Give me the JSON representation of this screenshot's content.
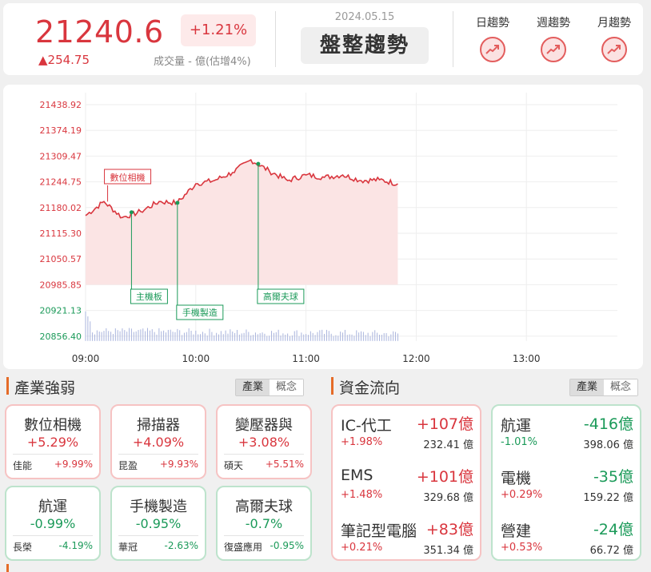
{
  "quote": {
    "price": "21240.6",
    "change": "▲254.75",
    "percent": "+1.21%",
    "volume": "成交量 - 億(估增4%)",
    "date": "2024.05.15",
    "trend": "盤整趨勢"
  },
  "trends": [
    {
      "label": "日趨勢",
      "icon": "trend-up-icon"
    },
    {
      "label": "週趨勢",
      "icon": "trend-up-icon"
    },
    {
      "label": "月趨勢",
      "icon": "trend-up-icon"
    }
  ],
  "colors": {
    "up": "#d9363e",
    "down": "#1b9a59",
    "accent": "#e56b28"
  },
  "chart_data": {
    "type": "line",
    "ylabels": [
      "21438.92",
      "21374.19",
      "21309.47",
      "21244.75",
      "21180.02",
      "21115.30",
      "21050.57",
      "20985.85",
      "20921.13",
      "20856.40"
    ],
    "ylim": [
      20856.4,
      21438.92
    ],
    "xlabels": [
      "09:00",
      "10:00",
      "11:00",
      "12:00",
      "13:00"
    ],
    "x_minutes": [
      0,
      10,
      20,
      30,
      40,
      50,
      60,
      70,
      80,
      90,
      100,
      110,
      120,
      130,
      140,
      150,
      160,
      170
    ],
    "values": [
      21160,
      21195,
      21155,
      21170,
      21195,
      21192,
      21240,
      21248,
      21268,
      21300,
      21272,
      21248,
      21262,
      21256,
      21262,
      21248,
      21250,
      21240
    ],
    "annotations": [
      {
        "label": "數位相機",
        "minute": 12,
        "value": 21195,
        "side": "up"
      },
      {
        "label": "主機板",
        "minute": 25,
        "value": 21168,
        "side": "down"
      },
      {
        "label": "手機製造",
        "minute": 50,
        "value": 21192,
        "side": "down"
      },
      {
        "label": "高爾夫球",
        "minute": 94,
        "value": 21290,
        "side": "down"
      }
    ]
  },
  "industry": {
    "title": "產業強弱",
    "tabs": [
      "產業",
      "概念"
    ],
    "cards": [
      {
        "name": "數位相機",
        "pct": "+5.29%",
        "stock": "佳能",
        "stock_pct": "+9.99%",
        "dir": "up"
      },
      {
        "name": "掃描器",
        "pct": "+4.09%",
        "stock": "昆盈",
        "stock_pct": "+9.93%",
        "dir": "up"
      },
      {
        "name": "變壓器與",
        "pct": "+3.08%",
        "stock": "碩天",
        "stock_pct": "+5.51%",
        "dir": "up"
      },
      {
        "name": "航運",
        "pct": "-0.99%",
        "stock": "長榮",
        "stock_pct": "-4.19%",
        "dir": "down"
      },
      {
        "name": "手機製造",
        "pct": "-0.95%",
        "stock": "華冠",
        "stock_pct": "-2.63%",
        "dir": "down"
      },
      {
        "name": "高爾夫球",
        "pct": "-0.7%",
        "stock": "復盛應用",
        "stock_pct": "-0.95%",
        "dir": "down"
      }
    ]
  },
  "flow": {
    "title": "資金流向",
    "tabs": [
      "產業",
      "概念"
    ],
    "inflow": [
      {
        "name": "IC-代工",
        "amount": "+107億",
        "pct": "+1.98%",
        "value": "232.41 億"
      },
      {
        "name": "EMS",
        "amount": "+101億",
        "pct": "+1.48%",
        "value": "329.68 億"
      },
      {
        "name": "筆記型電腦",
        "amount": "+83億",
        "pct": "+0.21%",
        "value": "351.34 億"
      }
    ],
    "outflow": [
      {
        "name": "航運",
        "amount": "-416億",
        "pct": "-1.01%",
        "value": "398.06 億"
      },
      {
        "name": "電機",
        "amount": "-35億",
        "pct": "+0.29%",
        "value": "159.22 億"
      },
      {
        "name": "營建",
        "amount": "-24億",
        "pct": "+0.53%",
        "value": "66.72 億"
      }
    ]
  }
}
